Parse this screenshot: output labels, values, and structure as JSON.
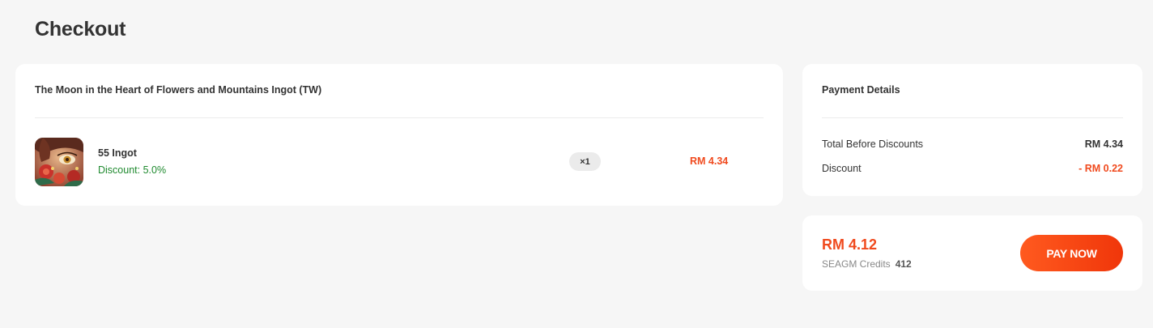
{
  "page": {
    "title": "Checkout"
  },
  "order": {
    "product_title": "The Moon in the Heart of Flowers and Mountains Ingot (TW)",
    "item": {
      "name": "55 Ingot",
      "discount": "Discount: 5.0%",
      "quantity": "×1",
      "price": "RM 4.34",
      "thumbnail_icon": "game-artwork-thumbnail"
    }
  },
  "payment_details": {
    "title": "Payment Details",
    "rows": [
      {
        "label": "Total Before Discounts",
        "value": "RM 4.34"
      },
      {
        "label": "Discount",
        "value": "- RM 0.22"
      }
    ]
  },
  "pay": {
    "total": "RM 4.12",
    "credits_label": "SEAGM Credits",
    "credits_value": "412",
    "button_label": "PAY NOW"
  },
  "colors": {
    "accent": "#f04a1e",
    "discount_green": "#1f8a2f",
    "background": "#f6f6f6"
  }
}
